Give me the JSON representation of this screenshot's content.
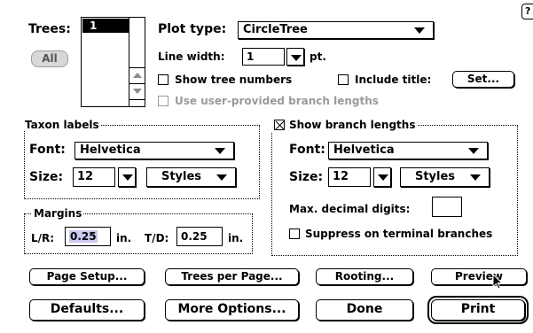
{
  "trees": {
    "label": "Trees:",
    "list_selected": "1",
    "all_button": "All"
  },
  "plot": {
    "plot_type_label": "Plot type:",
    "plot_type_value": "CircleTree",
    "line_width_label": "Line width:",
    "line_width_value": "1",
    "line_width_unit": "pt.",
    "show_tree_numbers": {
      "label": "Show tree numbers",
      "checked": false
    },
    "include_title": {
      "label": "Include title:",
      "checked": false
    },
    "set_button": "Set...",
    "user_branch_lengths": {
      "label": "Use user-provided branch lengths",
      "checked": false,
      "enabled": false
    }
  },
  "taxon_labels": {
    "title": "Taxon labels",
    "font_label": "Font:",
    "font_value": "Helvetica",
    "size_label": "Size:",
    "size_value": "12",
    "styles_label": "Styles"
  },
  "branch_lengths": {
    "title": "Show branch lengths",
    "checked": true,
    "font_label": "Font:",
    "font_value": "Helvetica",
    "size_label": "Size:",
    "size_value": "12",
    "styles_label": "Styles",
    "max_decimal_label": "Max. decimal digits:",
    "max_decimal_value": "",
    "suppress_label": "Suppress on terminal branches",
    "suppress_checked": false
  },
  "margins": {
    "title": "Margins",
    "lr_label": "L/R:",
    "lr_value": "0.25",
    "lr_unit": "in.",
    "td_label": "T/D:",
    "td_value": "0.25",
    "td_unit": "in."
  },
  "buttons": {
    "page_setup": "Page Setup...",
    "trees_per_page": "Trees per Page...",
    "rooting": "Rooting...",
    "preview": "Preview",
    "defaults": "Defaults...",
    "more_options": "More Options...",
    "done": "Done",
    "print": "Print"
  },
  "help": {
    "label": "?"
  }
}
